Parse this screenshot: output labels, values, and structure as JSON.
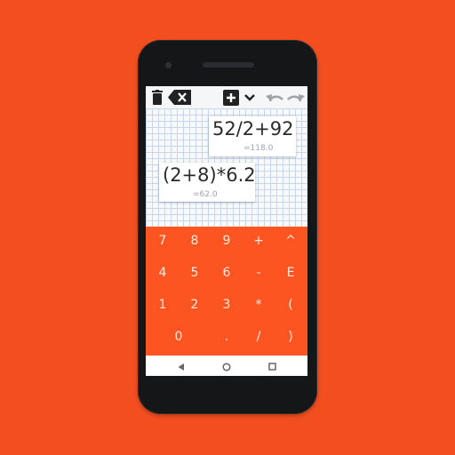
{
  "colors": {
    "background": "#f24e20",
    "phone_body": "#151617",
    "keypad": "#fd5522",
    "key_text": "#ffe9df",
    "paper_grid": "#c5d6ee"
  },
  "toolbar": {
    "icons": [
      "trash-icon",
      "backspace-icon",
      "add-box-icon",
      "chevron-down-icon",
      "undo-icon",
      "redo-icon"
    ]
  },
  "expressions": [
    {
      "formula": "52/2+92",
      "result": "=118.0"
    },
    {
      "formula": "(2+8)*6.2",
      "result": "=62.0"
    }
  ],
  "keypad": {
    "rows": [
      [
        "7",
        "8",
        "9",
        "+",
        "^"
      ],
      [
        "4",
        "5",
        "6",
        "-",
        "E"
      ],
      [
        "1",
        "2",
        "3",
        "*",
        "("
      ],
      [
        "0",
        ".",
        "/",
        ")"
      ]
    ]
  },
  "navbar": {
    "icons": [
      "back-icon",
      "home-icon",
      "recents-icon"
    ]
  }
}
